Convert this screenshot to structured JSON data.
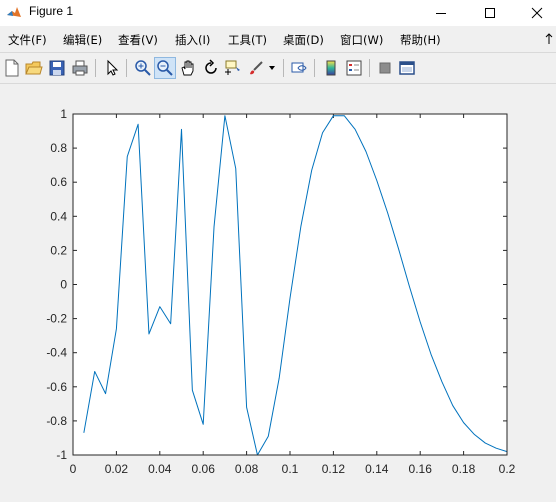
{
  "window": {
    "title": "Figure 1"
  },
  "menu": {
    "items": [
      {
        "label": "文件(F)"
      },
      {
        "label": "编辑(E)"
      },
      {
        "label": "查看(V)"
      },
      {
        "label": "插入(I)"
      },
      {
        "label": "工具(T)"
      },
      {
        "label": "桌面(D)"
      },
      {
        "label": "窗口(W)"
      },
      {
        "label": "帮助(H)"
      }
    ]
  },
  "toolbar": {
    "buttons": [
      "new-figure-icon",
      "open-file-icon",
      "save-icon",
      "print-icon",
      "select-arrow-icon",
      "zoom-in-icon",
      "zoom-out-icon",
      "pan-hand-icon",
      "rotate-3d-icon",
      "data-cursor-icon",
      "brush-icon",
      "dropdown-arrow-icon",
      "link-plot-icon",
      "colorbar-icon",
      "legend-icon",
      "hide-plot-tools-icon",
      "show-plot-tools-icon"
    ],
    "active": "zoom-out-icon"
  },
  "colors": {
    "line": "#0072bd",
    "axes_bg": "#ffffff",
    "window_bg": "#f0f0f0"
  },
  "chart_data": {
    "type": "line",
    "xlim": [
      0,
      0.2
    ],
    "ylim": [
      -1,
      1
    ],
    "xticks": [
      0,
      0.02,
      0.04,
      0.06,
      0.08,
      0.1,
      0.12,
      0.14,
      0.16,
      0.18,
      0.2
    ],
    "xtick_labels": [
      "0",
      "0.02",
      "0.04",
      "0.06",
      "0.08",
      "0.1",
      "0.12",
      "0.14",
      "0.16",
      "0.18",
      "0.2"
    ],
    "yticks": [
      -1,
      -0.8,
      -0.6,
      -0.4,
      -0.2,
      0,
      0.2,
      0.4,
      0.6,
      0.8,
      1
    ],
    "ytick_labels": [
      "-1",
      "-0.8",
      "-0.6",
      "-0.4",
      "-0.2",
      "0",
      "0.2",
      "0.4",
      "0.6",
      "0.8",
      "1"
    ],
    "grid": false,
    "series": [
      {
        "x": [
          0.005,
          0.01,
          0.015,
          0.02,
          0.025,
          0.03,
          0.035,
          0.04,
          0.045,
          0.05,
          0.055,
          0.06,
          0.065,
          0.07,
          0.075,
          0.08,
          0.085,
          0.09,
          0.095,
          0.1,
          0.105,
          0.11,
          0.115,
          0.12,
          0.125,
          0.13,
          0.135,
          0.14,
          0.145,
          0.15,
          0.155,
          0.16,
          0.165,
          0.17,
          0.175,
          0.18,
          0.185,
          0.19,
          0.195,
          0.2
        ],
        "y": [
          -0.87,
          -0.51,
          -0.64,
          -0.26,
          0.75,
          0.94,
          -0.29,
          -0.13,
          -0.23,
          0.91,
          -0.62,
          -0.82,
          0.34,
          0.99,
          0.68,
          -0.72,
          -1.0,
          -0.89,
          -0.55,
          -0.08,
          0.34,
          0.67,
          0.89,
          0.99,
          0.99,
          0.91,
          0.78,
          0.61,
          0.42,
          0.21,
          -0.01,
          -0.22,
          -0.41,
          -0.57,
          -0.71,
          -0.81,
          -0.88,
          -0.93,
          -0.96,
          -0.98
        ]
      }
    ]
  }
}
